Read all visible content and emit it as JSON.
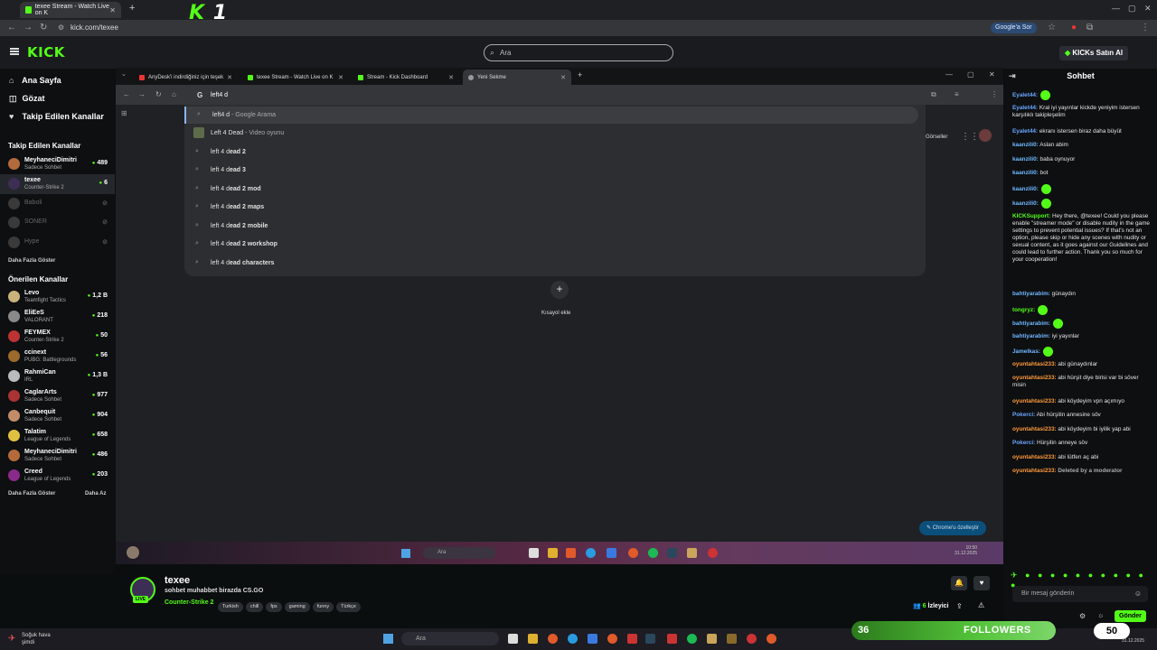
{
  "outer_tabs": [
    {
      "label": "texee Stream - Watch Live on K"
    }
  ],
  "brand_overlay": {
    "letter": "K",
    "number": "1"
  },
  "address": {
    "url": "kick.com/texee",
    "google_btn": "Google'a Sor"
  },
  "kick": {
    "logo": "KICK",
    "search_placeholder": "Ara",
    "buy_btn": "KICKs Satın Al"
  },
  "sidebar": {
    "nav": [
      {
        "label": "Ana Sayfa",
        "icon": "home-icon"
      },
      {
        "label": "Gözat",
        "icon": "browse-icon"
      },
      {
        "label": "Takip Edilen Kanallar",
        "icon": "heart-icon"
      }
    ],
    "followed_title": "Takip Edilen Kanallar",
    "followed": [
      {
        "name": "MeyhaneciDimitri",
        "category": "Sadece Sohbet",
        "count": "489"
      },
      {
        "name": "texee",
        "category": "Counter-Strike 2",
        "count": "6"
      },
      {
        "name": "Baboli",
        "category": "",
        "count": ""
      },
      {
        "name": "SONER",
        "category": "",
        "count": ""
      },
      {
        "name": "Hype",
        "category": "",
        "count": ""
      }
    ],
    "show_more": "Daha Fazla Göster",
    "recommended_title": "Önerilen Kanallar",
    "recommended": [
      {
        "name": "Levo",
        "category": "Teamfight Tactics",
        "count": "1,2 B"
      },
      {
        "name": "EliEeS",
        "category": "VALORANT",
        "count": "218"
      },
      {
        "name": "FEYMEX",
        "category": "Counter-Strike 2",
        "count": "50"
      },
      {
        "name": "ccinext",
        "category": "PUBG: Battlegrounds",
        "count": "56"
      },
      {
        "name": "RahmiCan",
        "category": "IRL",
        "count": "1,3 B"
      },
      {
        "name": "CaglarArts",
        "category": "Sadece Sohbet",
        "count": "977"
      },
      {
        "name": "Canbequit",
        "category": "Sadece Sohbet",
        "count": "904"
      },
      {
        "name": "Talatim",
        "category": "League of Legends",
        "count": "658"
      },
      {
        "name": "MeyhaneciDimitri",
        "category": "Sadece Sohbet",
        "count": "486"
      },
      {
        "name": "Creed",
        "category": "League of Legends",
        "count": "203"
      }
    ],
    "show_more2": "Daha Fazla Göster",
    "show_less": "Daha Az"
  },
  "inner_browser": {
    "tabs": [
      {
        "label": "AnyDesk'i indirdiğiniz için teşek"
      },
      {
        "label": "texee Stream - Watch Live on K"
      },
      {
        "label": "Stream - Kick Dashboard"
      },
      {
        "label": "Yeni Sekme"
      }
    ],
    "omnibox_value": "left4 d",
    "suggestions": [
      {
        "bold": "left4 d",
        "rest": " - Google Arama"
      },
      {
        "bold": "Left 4 Dead",
        "rest": " - Video oyunu"
      },
      {
        "bold": "left 4 d",
        "rest": "ead 2"
      },
      {
        "bold": "left 4 d",
        "rest": "ead 3"
      },
      {
        "bold": "left 4 d",
        "rest": "ead 2 mod"
      },
      {
        "bold": "left 4 d",
        "rest": "ead 2 maps"
      },
      {
        "bold": "left 4 d",
        "rest": "ead 2 mobile"
      },
      {
        "bold": "left 4 d",
        "rest": "ead 2 workshop"
      },
      {
        "bold": "left 4 d",
        "rest": "ead characters"
      }
    ],
    "images_link": "Görseller",
    "shortcut_label": "Kısayol ekle",
    "customize_btn": "Chrome'u özelleştir",
    "taskbar_search": "Ara",
    "clock": {
      "time": "10:50",
      "date": "31.12.2025"
    }
  },
  "chat": {
    "title": "Sohbet",
    "messages": [
      {
        "user": "Eyalet44:",
        "text": "",
        "color": "u-blue"
      },
      {
        "user": "Eyalet44:",
        "text": " Kral iyi yayınlar kickde yeniyim istersen karşılıklı takipleşelim",
        "color": "u-blue"
      },
      {
        "user": "Eyalet44:",
        "text": " ekranı istersen biraz daha büyüt",
        "color": "u-blue"
      },
      {
        "user": "kaanzili0:",
        "text": " Aslan abim",
        "color": "u-lblue"
      },
      {
        "user": "kaanzili0:",
        "text": " baba oynuyor",
        "color": "u-lblue"
      },
      {
        "user": "kaanzili0:",
        "text": " bot",
        "color": "u-lblue"
      },
      {
        "user": "kaanzili0:",
        "text": "",
        "color": "u-lblue"
      },
      {
        "user": "kaanzili0:",
        "text": "",
        "color": "u-lblue"
      },
      {
        "user": "KICKSupport:",
        "text": " Hey there, @texee! Could you please enable \"streamer mode\" or disable nudity in the game settings to prevent potential issues? If that's not an option, please skip or hide any scenes with nudity or sexual content, as it goes against our Guidelines and could lead to further action. Thank you so much for your cooperation!",
        "color": "u-green"
      },
      {
        "user": "bahtiyarabim:",
        "text": " günaydın",
        "color": "u-lblue"
      },
      {
        "user": "tongryz:",
        "text": "",
        "color": "u-green"
      },
      {
        "user": "bahtiyarabim:",
        "text": "",
        "color": "u-lblue"
      },
      {
        "user": "bahtiyarabim:",
        "text": " iyi yayınlar",
        "color": "u-lblue"
      },
      {
        "user": "Jamelkas:",
        "text": "",
        "color": "u-lblue"
      },
      {
        "user": "oyuntahtasi233:",
        "text": " abi günaydınlar",
        "color": "u-orange"
      },
      {
        "user": "oyuntahtasi233:",
        "text": " abi hürşit diye birisi var bi söver misin",
        "color": "u-orange"
      },
      {
        "user": "oyuntahtasi233:",
        "text": " abi köydeyim vpn açımıyo",
        "color": "u-orange"
      },
      {
        "user": "Pokerci:",
        "text": " Abi hürşitin annesine söv",
        "color": "u-blue"
      },
      {
        "user": "oyuntahtasi233:",
        "text": " abi köydeyim bi iyilik yap abi",
        "color": "u-orange"
      },
      {
        "user": "Pokerci:",
        "text": " Hürşitin anneye söv",
        "color": "u-blue"
      },
      {
        "user": "oyuntahtasi233:",
        "text": " abi lütfen aç abi",
        "color": "u-orange"
      },
      {
        "user": "oyuntahtasi233:",
        "text": " Deleted by a moderator",
        "color": "u-orange"
      }
    ],
    "input_placeholder": "Bir mesaj gönderin",
    "send_btn": "Gönder"
  },
  "stream": {
    "name": "texee",
    "title": "sohbet muhabbet birazda CS.GO",
    "category": "Counter-Strike 2",
    "tags": [
      "Turkish",
      "chill",
      "fps",
      "gaming",
      "funny",
      "Türkçe"
    ],
    "live": "LIVE",
    "viewers_count": "6",
    "viewers_label": "İzleyici"
  },
  "taskbar": {
    "weather_1": "Soğuk hava",
    "weather_2": "şimdi",
    "search": "Ara",
    "date": "31.12.2025"
  },
  "followers_widget": {
    "current": "36",
    "label": "FOLLOWERS",
    "goal": "50",
    "progress_fraction": 0.72
  }
}
